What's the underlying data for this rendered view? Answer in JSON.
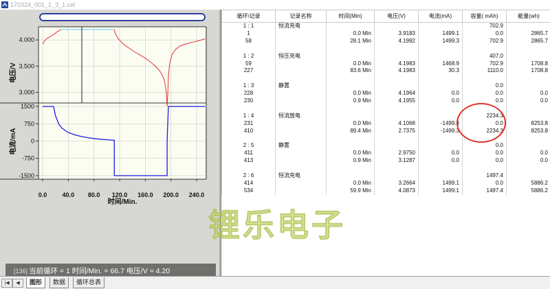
{
  "window": {
    "title": "170324_001_1_3_1.cel"
  },
  "chart": {
    "voltage_ylabel": "电压/V",
    "current_ylabel": "电流/mA",
    "xlabel": "时间/Min.",
    "voltage_ticks": [
      "4.000",
      "3.500",
      "3.000"
    ],
    "current_ticks": [
      "1500",
      "750",
      "0",
      "-750",
      "-1500"
    ],
    "x_ticks": [
      "0.0",
      "40.0",
      "80.0",
      "120.0",
      "160.0",
      "200.0",
      "240.0"
    ],
    "colors": {
      "voltage": "#e03030",
      "current": "#1a1ae0",
      "cv_line": "#66ccee"
    }
  },
  "status": {
    "num": "[136]",
    "text": "当前循环 = 1   时间/Min. = 66.7  电压/V = 4.20"
  },
  "chart_data": [
    {
      "type": "line",
      "ylabel": "电压/V",
      "xlabel": "时间/Min.",
      "xlim": [
        0,
        255
      ],
      "ylim": [
        2.8,
        4.25
      ],
      "series": [
        {
          "x": [
            0,
            3,
            6,
            10,
            14,
            18,
            22,
            26,
            28.1,
            40,
            60,
            80,
            100,
            111.7,
            113,
            118,
            125,
            135,
            145,
            155,
            165,
            175,
            182,
            186,
            189,
            191,
            192.5,
            193.5,
            194,
            195,
            196,
            198,
            202,
            208,
            215,
            225,
            235,
            245,
            253
          ],
          "y": [
            3.92,
            3.98,
            4.02,
            4.05,
            4.08,
            4.11,
            4.15,
            4.18,
            4.198,
            4.198,
            4.198,
            4.198,
            4.198,
            4.198,
            4.13,
            4.02,
            3.93,
            3.84,
            3.76,
            3.69,
            3.61,
            3.51,
            3.42,
            3.34,
            3.26,
            3.15,
            3.02,
            2.86,
            2.74,
            2.95,
            3.3,
            3.55,
            3.73,
            3.83,
            3.89,
            3.93,
            3.96,
            3.99,
            4.02
          ]
        }
      ]
    },
    {
      "type": "line",
      "ylabel": "电流/mA",
      "xlabel": "时间/Min.",
      "xlim": [
        0,
        255
      ],
      "ylim": [
        -1650,
        1650
      ],
      "x_ticks": [
        0,
        40,
        80,
        120,
        160,
        200,
        240
      ],
      "series": [
        {
          "x": [
            0,
            10,
            17,
            20,
            25,
            30,
            40,
            50,
            60,
            70,
            80,
            90,
            100,
            108,
            111.7,
            111.7,
            194,
            194,
            196,
            253
          ],
          "y": [
            1499,
            1499,
            1499,
            1100,
            750,
            560,
            370,
            270,
            200,
            150,
            110,
            80,
            60,
            45,
            30,
            -1499,
            -1499,
            0,
            1499,
            1499
          ]
        }
      ]
    }
  ],
  "table": {
    "headers": [
      "循环\\记录",
      "记录名称",
      "时间(Min)",
      "电压(V)",
      "电流(mA)",
      "容量( mAh)",
      "能量(wh)"
    ],
    "rows": [
      [
        "1 : 1",
        "恒流充电",
        "",
        "",
        "",
        "702.9",
        ""
      ],
      [
        "1",
        "",
        "0.0 Min",
        "3.9183",
        "1499.1",
        "0.0",
        "2865.7"
      ],
      [
        "58",
        "",
        "28.1 Min",
        "4.1992",
        "1499.3",
        "702.9",
        "2865.7"
      ],
      [
        "",
        "",
        "",
        "",
        "",
        "",
        ""
      ],
      [
        "1 : 2",
        "恒压充电",
        "",
        "",
        "",
        "407.0",
        ""
      ],
      [
        "59",
        "",
        "0.0 Min",
        "4.1983",
        "1468.9",
        "702.9",
        "1708.8"
      ],
      [
        "227",
        "",
        "83.6 Min",
        "4.1983",
        "30.3",
        "1110.0",
        "1708.8"
      ],
      [
        "",
        "",
        "",
        "",
        "",
        "",
        ""
      ],
      [
        "1 : 3",
        "静置",
        "",
        "",
        "",
        "0.0",
        ""
      ],
      [
        "228",
        "",
        "0.0 Min",
        "4.1964",
        "0.0",
        "0.0",
        "0.0"
      ],
      [
        "230",
        "",
        "0.9 Min",
        "4.1955",
        "0.0",
        "0.0",
        "0.0"
      ],
      [
        "",
        "",
        "",
        "",
        "",
        "",
        ""
      ],
      [
        "1 : 4",
        "恒流放电",
        "",
        "",
        "",
        "2234.3",
        ""
      ],
      [
        "231",
        "",
        "0.0 Min",
        "4.1068",
        "-1499.3",
        "0.0",
        "8253.8"
      ],
      [
        "410",
        "",
        "89.4 Min",
        "2.7375",
        "-1499.3",
        "2234.3",
        "8253.8"
      ],
      [
        "",
        "",
        "",
        "",
        "",
        "",
        ""
      ],
      [
        "2 : 5",
        "静置",
        "",
        "",
        "",
        "0.0",
        ""
      ],
      [
        "411",
        "",
        "0.0 Min",
        "2.9750",
        "0.0",
        "0.0",
        "0.0"
      ],
      [
        "413",
        "",
        "0.9 Min",
        "3.1287",
        "0.0",
        "0.0",
        "0.0"
      ],
      [
        "",
        "",
        "",
        "",
        "",
        "",
        ""
      ],
      [
        "2 : 6",
        "恒流充电",
        "",
        "",
        "",
        "1497.4",
        ""
      ],
      [
        "414",
        "",
        "0.0 Min",
        "3.2664",
        "1499.1",
        "0.0",
        "5886.2"
      ],
      [
        "534",
        "",
        "59.9 Min",
        "4.0873",
        "1499.1",
        "1497.4",
        "5886.2"
      ]
    ]
  },
  "watermark": "锂乐电子",
  "tabs": {
    "graph": "图形",
    "data": "数据",
    "cycle": "循环总表",
    "first": "|◀",
    "prev": "◀",
    "next": "▶",
    "last": "▶|"
  }
}
